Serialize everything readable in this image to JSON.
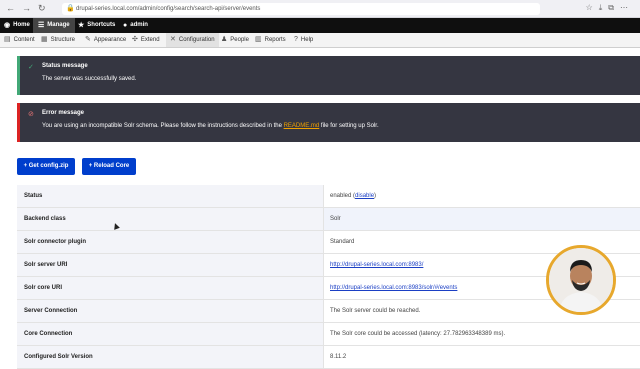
{
  "browser": {
    "url": "drupal-series.local.com/admin/config/search/search-api/server/events"
  },
  "toolbar": {
    "items": [
      {
        "label": "Home",
        "icon": "drupal-drop-icon"
      },
      {
        "label": "Manage",
        "icon": "menu-icon"
      },
      {
        "label": "Shortcuts",
        "icon": "star-icon"
      },
      {
        "label": "admin",
        "icon": "user-icon"
      }
    ]
  },
  "tray": {
    "items": [
      {
        "label": "Content",
        "icon": "content-icon"
      },
      {
        "label": "Structure",
        "icon": "structure-icon"
      },
      {
        "label": "Appearance",
        "icon": "brush-icon"
      },
      {
        "label": "Extend",
        "icon": "puzzle-icon"
      },
      {
        "label": "Configuration",
        "icon": "wrench-icon"
      },
      {
        "label": "People",
        "icon": "people-icon"
      },
      {
        "label": "Reports",
        "icon": "chart-icon"
      },
      {
        "label": "Help",
        "icon": "help-icon"
      }
    ]
  },
  "status_message": {
    "title": "Status message",
    "body": "The server was successfully saved."
  },
  "error_message": {
    "title": "Error message",
    "body_before": "You are using an incompatible Solr schema. Please follow the instructions described in the ",
    "link": "README.md",
    "body_after": " file for setting up Solr."
  },
  "buttons": {
    "get_config": "+ Get config.zip",
    "reload_core": "+ Reload Core"
  },
  "details": [
    {
      "label": "Status",
      "value": "enabled (",
      "link": "disable",
      "suffix": ")"
    },
    {
      "label": "Backend class",
      "value": "Solr"
    },
    {
      "label": "Solr connector plugin",
      "value": "Standard"
    },
    {
      "label": "Solr server URI",
      "value": "",
      "link": "http://drupal-series.local.com:8983/"
    },
    {
      "label": "Solr core URI",
      "value": "",
      "link": "http://drupal-series.local.com:8983/solr/#/events"
    },
    {
      "label": "Server Connection",
      "value": "The Solr server could be reached."
    },
    {
      "label": "Core Connection",
      "value": "The Solr core could be accessed (latency: 27.782963348389 ms)."
    },
    {
      "label": "Configured Solr Version",
      "value": "8.11.2"
    }
  ]
}
